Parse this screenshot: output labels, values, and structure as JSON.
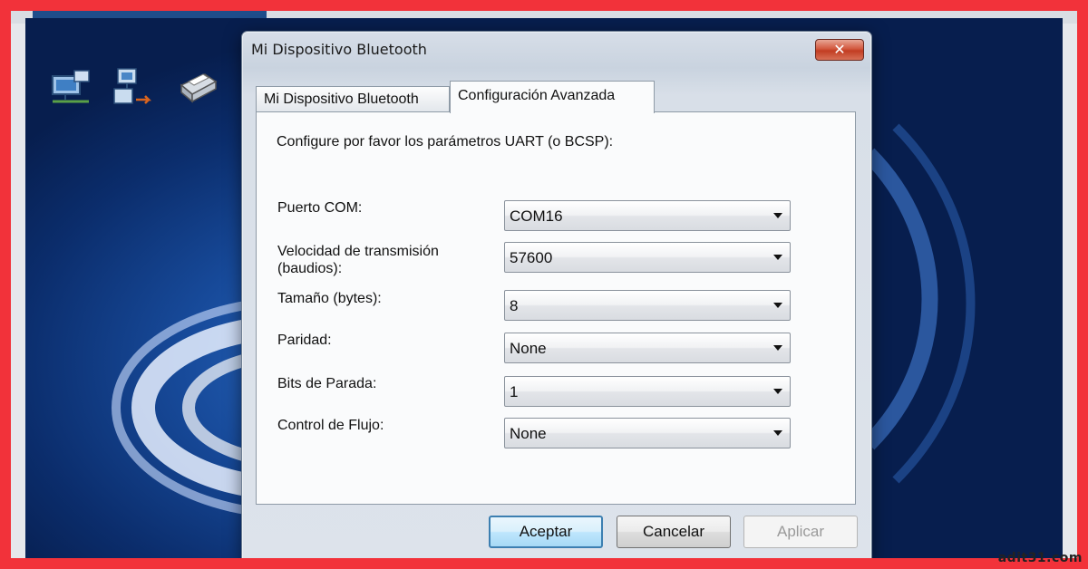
{
  "dialog": {
    "title": "Mi Dispositivo Bluetooth",
    "close_glyph": "✕",
    "tabs": [
      {
        "label": "Mi Dispositivo Bluetooth",
        "active": false
      },
      {
        "label": "Configuración Avanzada",
        "active": true
      }
    ],
    "intro": "Configure por favor los parámetros UART (o BCSP):",
    "fields": {
      "com_port": {
        "label": "Puerto COM:",
        "value": "COM16"
      },
      "baud_rate": {
        "label_line1": "Velocidad de transmisión",
        "label_line2": "(baudios):",
        "value": "57600"
      },
      "byte_size": {
        "label": "Tamaño (bytes):",
        "value": "8"
      },
      "parity": {
        "label": "Paridad:",
        "value": "None"
      },
      "stop_bits": {
        "label": "Bits de Parada:",
        "value": "1"
      },
      "flow_control": {
        "label": "Control de Flujo:",
        "value": "None"
      }
    },
    "buttons": {
      "ok": "Aceptar",
      "cancel": "Cancelar",
      "apply": "Aplicar",
      "apply_enabled": false
    }
  },
  "desktop": {
    "icons": [
      "network-computer-icon",
      "network-share-icon",
      "printer-icon"
    ]
  },
  "watermark": "adit31.com",
  "colors": {
    "border_frame": "#f2323a",
    "desktop_blue": "#0b2d6c",
    "close_button": "#c23d22",
    "default_button_border": "#3c7fb1"
  }
}
